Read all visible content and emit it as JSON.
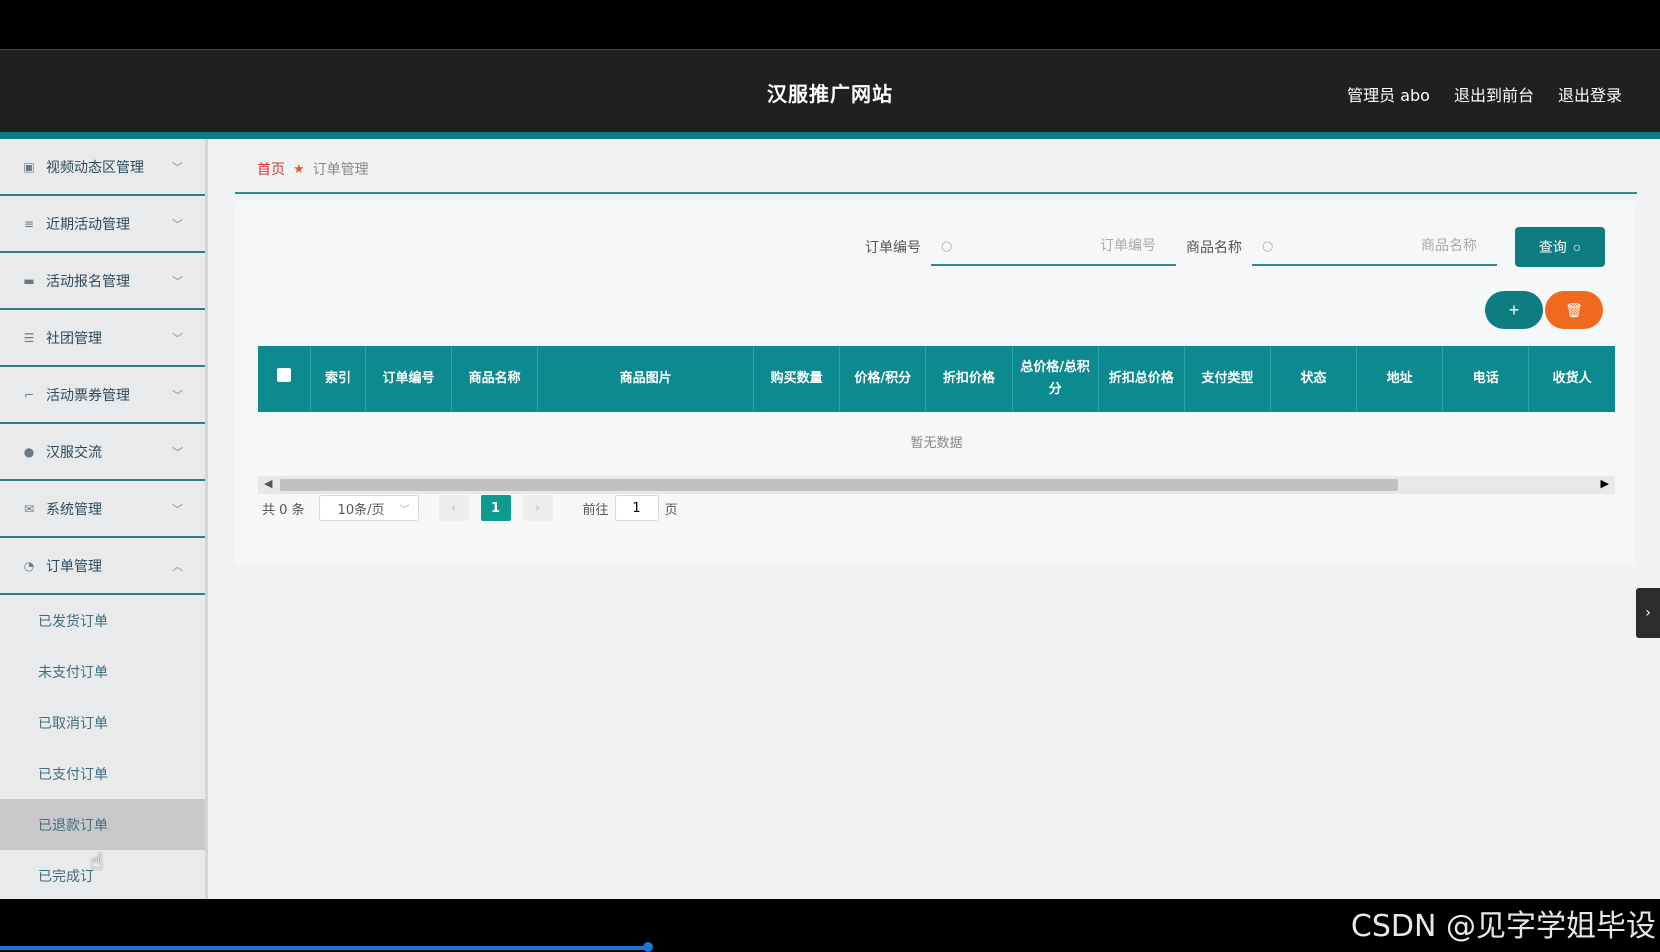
{
  "header": {
    "site_title": "汉服推广网站",
    "admin_label": "管理员 abo",
    "to_frontend": "退出到前台",
    "logout": "退出登录"
  },
  "sidebar": {
    "items": [
      {
        "label": "视频动态区管理",
        "icon": "clipboard-icon"
      },
      {
        "label": "近期活动管理",
        "icon": "list-icon"
      },
      {
        "label": "活动报名管理",
        "icon": "chat-icon"
      },
      {
        "label": "社团管理",
        "icon": "sliders-icon"
      },
      {
        "label": "活动票券管理",
        "icon": "crop-icon"
      },
      {
        "label": "汉服交流",
        "icon": "user-icon"
      },
      {
        "label": "系统管理",
        "icon": "mail-icon"
      },
      {
        "label": "订单管理",
        "icon": "gauge-icon"
      }
    ],
    "subitems": [
      "已发货订单",
      "未支付订单",
      "已取消订单",
      "已支付订单",
      "已退款订单",
      "已完成订"
    ]
  },
  "breadcrumb": {
    "home": "首页",
    "current": "订单管理"
  },
  "search": {
    "order_no_label": "订单编号",
    "order_no_placeholder": "订单编号",
    "product_label": "商品名称",
    "product_placeholder": "商品名称",
    "query_label": "查询"
  },
  "table": {
    "columns": [
      "索引",
      "订单编号",
      "商品名称",
      "商品图片",
      "购买数量",
      "价格/积分",
      "折扣价格",
      "总价格/总积分",
      "折扣总价格",
      "支付类型",
      "状态",
      "地址",
      "电话",
      "收货人",
      ""
    ],
    "empty_text": "暂无数据"
  },
  "pager": {
    "total": "共 0 条",
    "page_size": "10条/页",
    "current_page": "1",
    "goto_label": "前往",
    "goto_value": "1",
    "page_suffix": "页"
  },
  "watermark": "CSDN @见字学姐毕设",
  "colors": {
    "primary": "#0d7d81",
    "danger": "#f06a1e",
    "header_bg": "#202020"
  }
}
